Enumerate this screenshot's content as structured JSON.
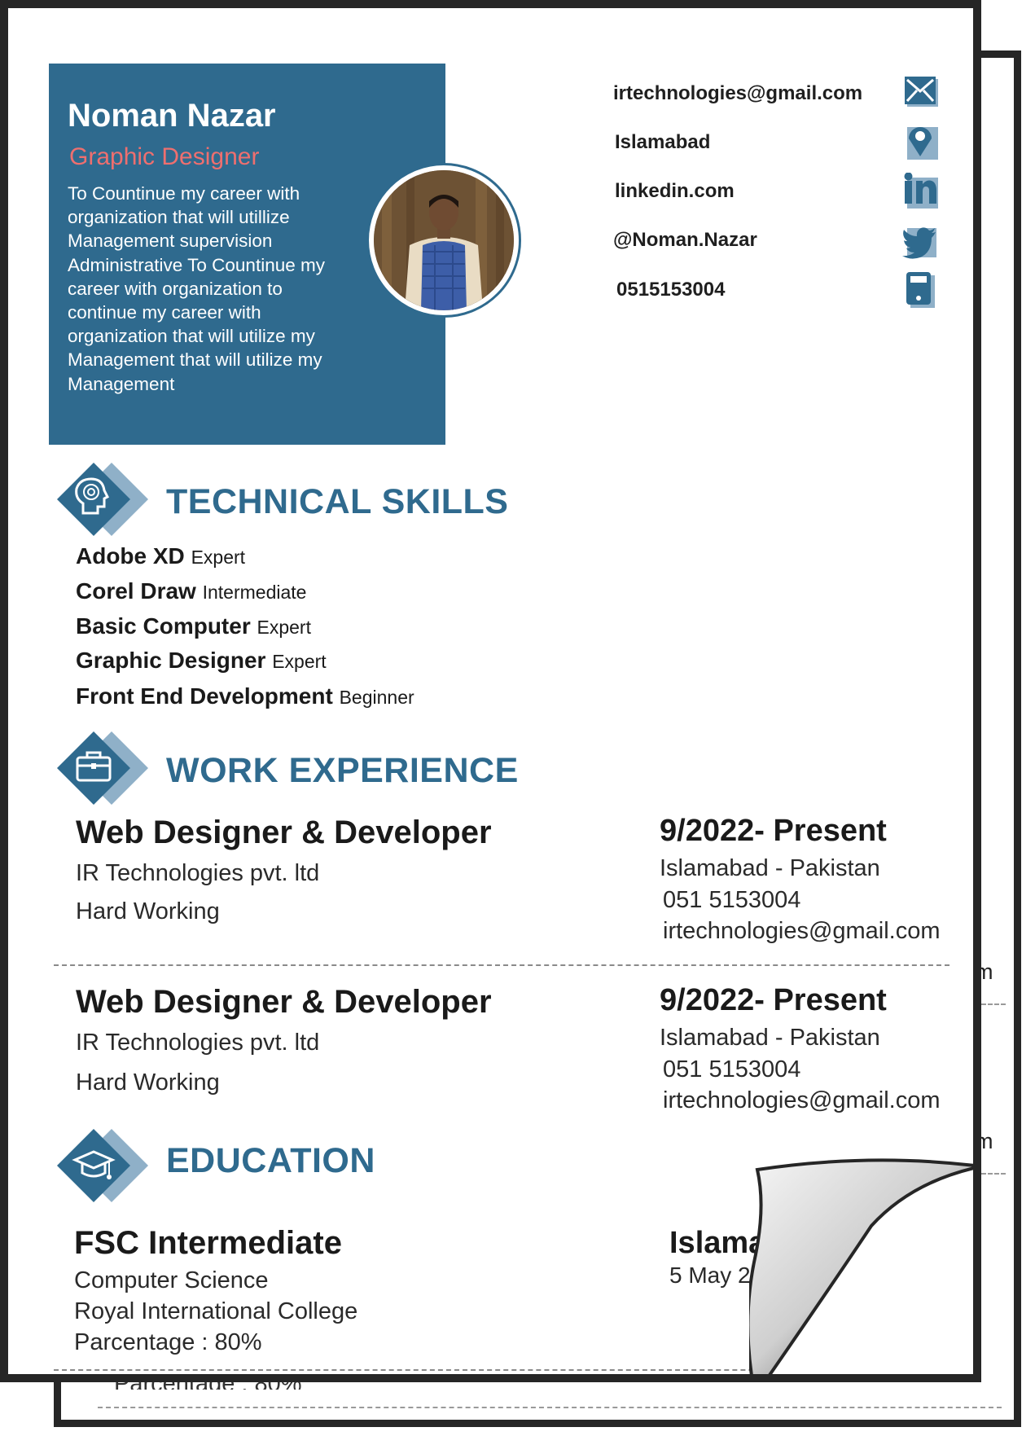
{
  "profile": {
    "name": "Noman Nazar",
    "role": "Graphic Designer",
    "summary": "To Countinue my career with organization that will utillize Management supervision Administrative To Countinue my  career with organization to continue my career with organization that will utilize my Management that will utilize my Management"
  },
  "contacts": [
    {
      "text": "irtechnologies@gmail.com",
      "icon": "mail-icon"
    },
    {
      "text": "Islamabad",
      "icon": "location-pin-icon"
    },
    {
      "text": "linkedin.com",
      "icon": "linkedin-icon"
    },
    {
      "text": "@Noman.Nazar",
      "icon": "twitter-icon"
    },
    {
      "text": "0515153004",
      "icon": "phone-icon"
    }
  ],
  "sections": {
    "skills": "TECHNICAL SKILLS",
    "work": "WORK EXPERIENCE",
    "education": "EDUCATION"
  },
  "skills": [
    {
      "name": "Adobe XD",
      "level": "Expert"
    },
    {
      "name": "Corel Draw",
      "level": "Intermediate"
    },
    {
      "name": "Basic Computer",
      "level": "Expert"
    },
    {
      "name": "Graphic Designer",
      "level": "Expert"
    },
    {
      "name": "Front End Development",
      "level": "Beginner"
    }
  ],
  "jobs": [
    {
      "title": "Web Designer & Developer",
      "company": "IR Technologies pvt. ltd",
      "trait": "Hard Working",
      "date": "9/2022- Present",
      "location": "Islamabad - Pakistan",
      "phone": "051 5153004",
      "email": "irtechnologies@gmail.com"
    },
    {
      "title": "Web Designer & Developer",
      "company": "IR Technologies pvt. ltd",
      "trait": "Hard Working",
      "date": "9/2022- Present",
      "location": "Islamabad - Pakistan",
      "phone": "051 5153004",
      "email": "irtechnologies@gmail.com"
    }
  ],
  "education": {
    "degree": "FSC Intermediate",
    "field": "Computer Science",
    "college": "Royal International College",
    "percentage": "Parcentage : 80%",
    "city_partial": "Islama",
    "date_partial": "5 May 20"
  },
  "back_page": {
    "fragment_m1": "m",
    "fragment_m2": "m",
    "fragment_bottom": "Parcentage : 80%"
  },
  "colors": {
    "accent": "#2f6a8e",
    "accent_light": "#8fb0c8",
    "role": "#ee6f6f",
    "frame": "#262626"
  }
}
